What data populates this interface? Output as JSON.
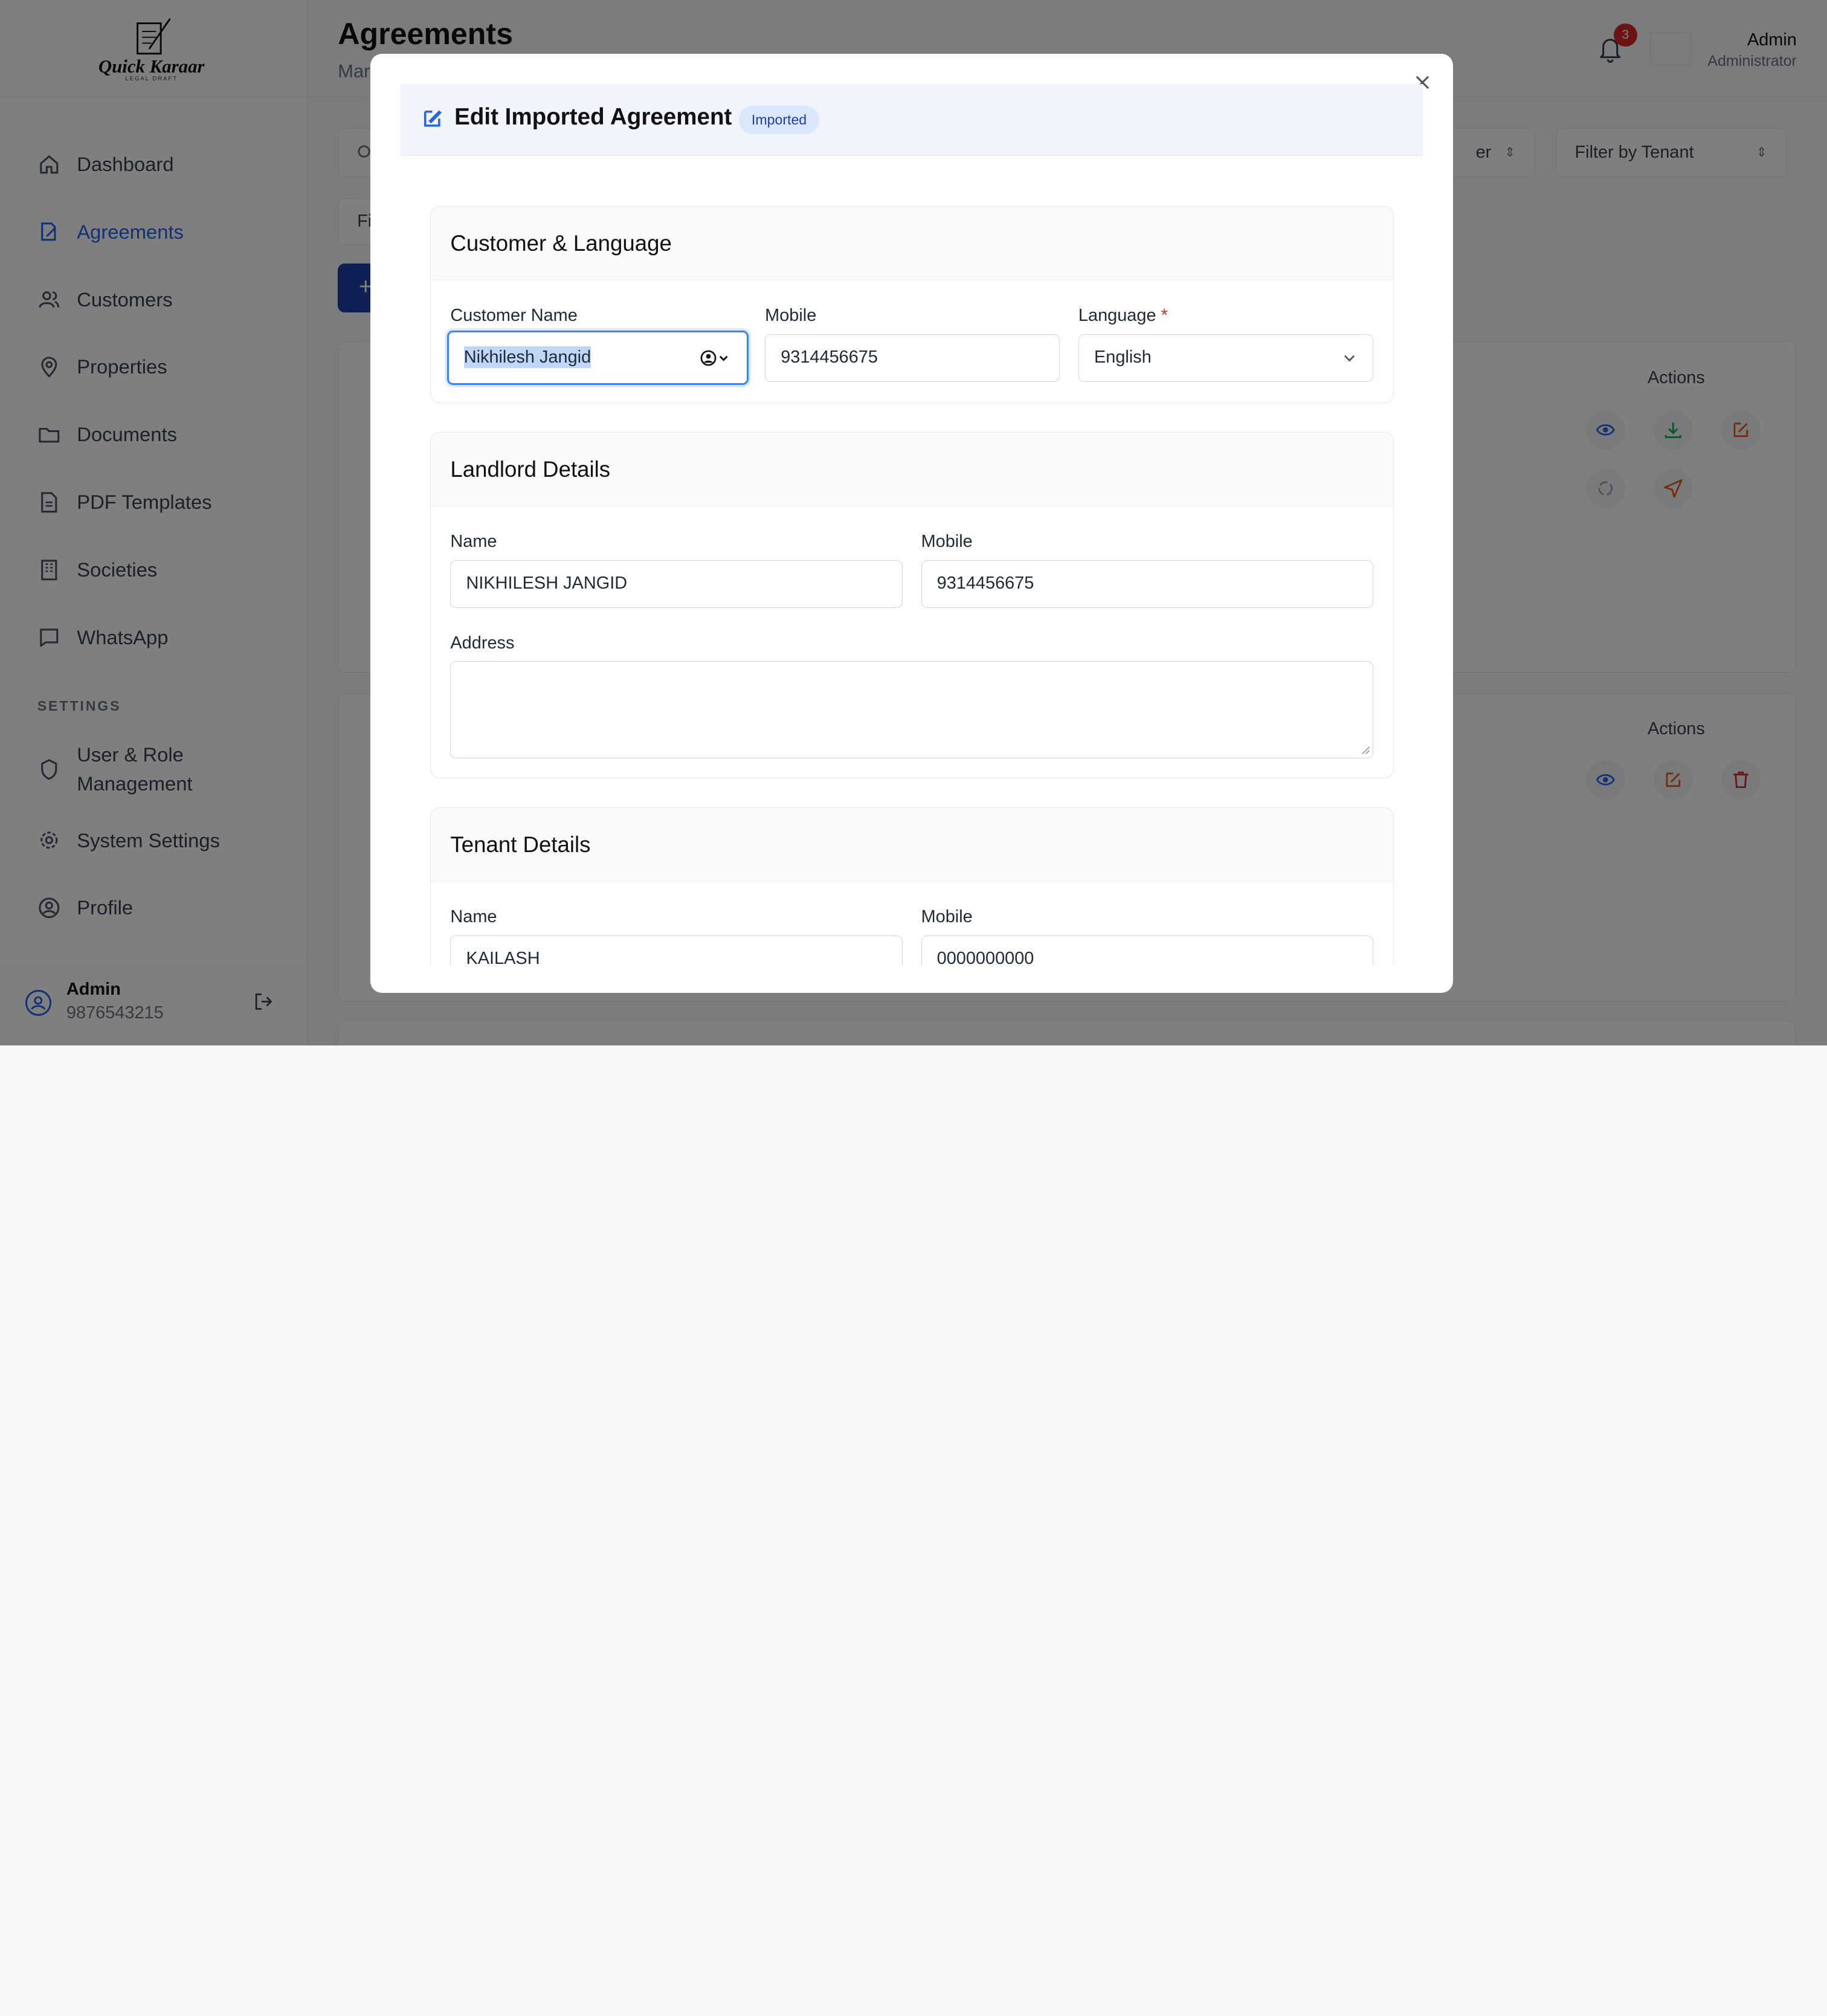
{
  "sidebar": {
    "brand": "Quick Karaar",
    "brand_sub": "LEGAL DRAFT",
    "items": [
      {
        "label": "Dashboard",
        "icon": "home-icon"
      },
      {
        "label": "Agreements",
        "icon": "edit-document-icon"
      },
      {
        "label": "Customers",
        "icon": "users-icon"
      },
      {
        "label": "Properties",
        "icon": "map-pin-icon"
      },
      {
        "label": "Documents",
        "icon": "folder-icon"
      },
      {
        "label": "PDF Templates",
        "icon": "file-text-icon"
      },
      {
        "label": "Societies",
        "icon": "building-icon"
      },
      {
        "label": "WhatsApp",
        "icon": "chat-icon"
      }
    ],
    "settings_label": "SETTINGS",
    "settings_items": [
      {
        "label": "User & Role Management",
        "icon": "shield-icon"
      },
      {
        "label": "System Settings",
        "icon": "gear-icon"
      },
      {
        "label": "Profile",
        "icon": "user-circle-icon"
      }
    ],
    "user": {
      "name": "Admin",
      "phone": "9876543215"
    }
  },
  "header": {
    "title": "Agreements",
    "subtitle": "Mar",
    "notifications_count": "3",
    "user_name": "Admin",
    "user_role": "Administrator"
  },
  "background": {
    "filter_partial": "er",
    "filter_tenant": "Filter by Tenant",
    "filter_left_partial": "Fi",
    "add_button": "+",
    "actions_label": "Actions"
  },
  "modal": {
    "title": "Edit Imported Agreement",
    "badge": "Imported",
    "sections": {
      "customer": {
        "title": "Customer & Language",
        "customer_name_label": "Customer Name",
        "customer_name_value": "Nikhilesh Jangid",
        "mobile_label": "Mobile",
        "mobile_value": "9314456675",
        "language_label": "Language",
        "language_required": "*",
        "language_value": "English"
      },
      "landlord": {
        "title": "Landlord Details",
        "name_label": "Name",
        "name_value": "NIKHILESH JANGID",
        "mobile_label": "Mobile",
        "mobile_value": "9314456675",
        "address_label": "Address",
        "address_value": ""
      },
      "tenant": {
        "title": "Tenant Details",
        "name_label": "Name",
        "name_value": "KAILASH",
        "mobile_label": "Mobile",
        "mobile_value": "0000000000"
      }
    }
  },
  "colors": {
    "accent": "#2563eb",
    "overlay": "rgba(0,0,0,0.5)",
    "badge_bg": "#dbe7fb",
    "danger": "#dc2626"
  }
}
